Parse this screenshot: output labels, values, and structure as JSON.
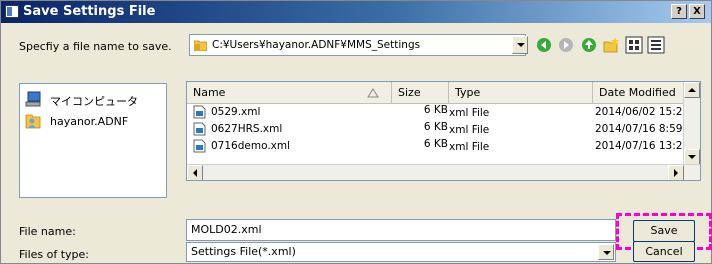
{
  "window": {
    "title": "Save Settings File",
    "help_btn": "?",
    "close_btn": "X"
  },
  "save_in": {
    "label": "Specfiy a file name to save.",
    "path": "C:¥Users¥hayanor.ADNF¥MMS_Settings"
  },
  "toolbar": {
    "icons": [
      "back-icon",
      "forward-icon",
      "up-folder-icon",
      "new-folder-icon",
      "list-view-icon",
      "details-view-icon"
    ]
  },
  "places": [
    {
      "label": "マイコンピュータ",
      "icon": "computer-icon"
    },
    {
      "label": "hayanor.ADNF",
      "icon": "user-folder-icon"
    }
  ],
  "file_list": {
    "columns": [
      "Name",
      "Size",
      "Type",
      "Date Modified"
    ],
    "rows": [
      {
        "name": "0529.xml",
        "size": "6 KB",
        "type": "xml File",
        "date": "2014/06/02 15:2"
      },
      {
        "name": "0627HRS.xml",
        "size": "6 KB",
        "type": "xml File",
        "date": "2014/07/16 8:59"
      },
      {
        "name": "0716demo.xml",
        "size": "6 KB",
        "type": "xml File",
        "date": "2014/07/16 13:2"
      }
    ]
  },
  "file_name": {
    "label": "File name:",
    "value": "MOLD02.xml"
  },
  "file_type": {
    "label": "Files of type:",
    "value": "Settings File(*.xml)"
  },
  "buttons": {
    "save": "Save",
    "cancel": "Cancel"
  },
  "colors": {
    "highlight": "#ff00cc",
    "titlebar": "#0a246a"
  }
}
